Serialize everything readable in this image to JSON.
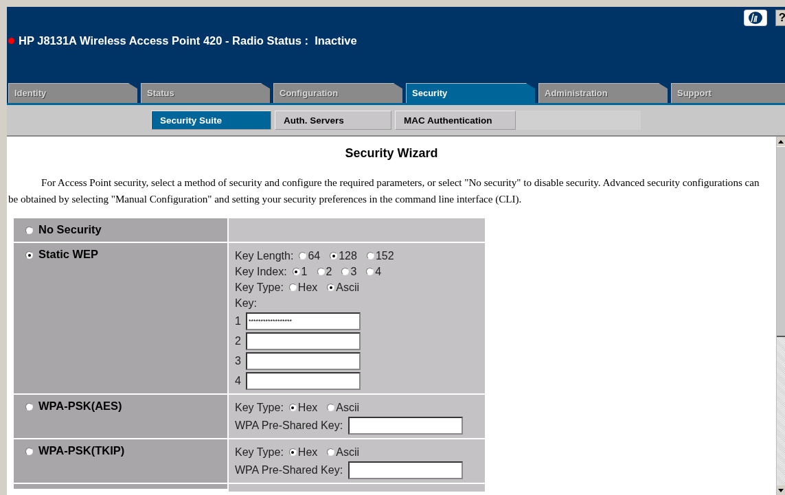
{
  "header": {
    "status_dot": {
      "color": "#ff0000"
    },
    "title": "HP J8131A Wireless Access Point 420 - Radio Status :  Inactive",
    "help": "?"
  },
  "tabs": [
    {
      "label": "Identity",
      "selected": false
    },
    {
      "label": "Status",
      "selected": false
    },
    {
      "label": "Configuration",
      "selected": false
    },
    {
      "label": "Security",
      "selected": true
    },
    {
      "label": "Administration",
      "selected": false
    },
    {
      "label": "Support",
      "selected": false
    }
  ],
  "subtabs": [
    {
      "label": "Security Suite",
      "selected": true
    },
    {
      "label": "Auth. Servers",
      "selected": false
    },
    {
      "label": "MAC Authentication",
      "selected": false
    }
  ],
  "heading": "Security Wizard",
  "intro": "For Access Point security, select a method of security and configure the required parameters, or select \"No security\" to disable security. Advanced security configurations can be obtained by selecting \"Manual Configuration\" and setting your security preferences in the command line interface (CLI).",
  "methods": [
    {
      "label": "No Security",
      "selected": false
    },
    {
      "label": "Static WEP",
      "selected": true,
      "fields": [
        {
          "kind": "radios",
          "label": "Key Length:",
          "choices": [
            {
              "label": "64",
              "selected": false
            },
            {
              "label": "128",
              "selected": true
            },
            {
              "label": "152",
              "selected": false
            }
          ]
        },
        {
          "kind": "radios",
          "label": "Key Index:",
          "choices": [
            {
              "label": "1",
              "selected": true
            },
            {
              "label": "2",
              "selected": false
            },
            {
              "label": "3",
              "selected": false
            },
            {
              "label": "4",
              "selected": false
            }
          ]
        },
        {
          "kind": "radios",
          "label": "Key Type:",
          "choices": [
            {
              "label": "Hex",
              "selected": false
            },
            {
              "label": "Ascii",
              "selected": true
            }
          ]
        },
        {
          "kind": "caption",
          "label": "Key:"
        },
        {
          "kind": "key",
          "label": "1",
          "value": "******************"
        },
        {
          "kind": "key",
          "label": "2"
        },
        {
          "kind": "key",
          "label": "3"
        },
        {
          "kind": "key",
          "label": "4"
        }
      ]
    },
    {
      "label": "WPA-PSK(AES)",
      "selected": false,
      "fields": [
        {
          "kind": "radios",
          "label": "Key Type:",
          "choices": [
            {
              "label": "Hex",
              "selected": true
            },
            {
              "label": "Ascii",
              "selected": false
            }
          ]
        },
        {
          "kind": "input",
          "label": "WPA Pre-Shared Key:"
        }
      ]
    },
    {
      "label": "WPA-PSK(TKIP)",
      "selected": false,
      "fields": [
        {
          "kind": "radios",
          "label": "Key Type:",
          "choices": [
            {
              "label": "Hex",
              "selected": true
            },
            {
              "label": "Ascii",
              "selected": false
            }
          ]
        },
        {
          "kind": "input",
          "label": "WPA Pre-Shared Key:"
        }
      ]
    }
  ]
}
